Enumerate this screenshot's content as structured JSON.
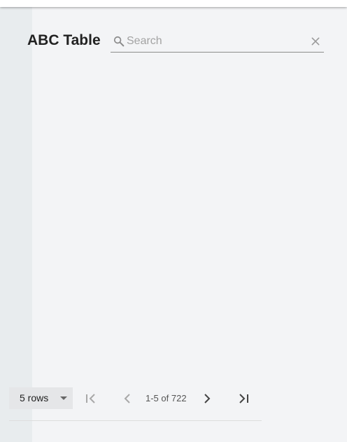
{
  "table": {
    "title": "ABC Table"
  },
  "search": {
    "placeholder": "Search",
    "value": ""
  },
  "pagination": {
    "rows_per_page_label": "5 rows",
    "page_info": "1-5 of 722"
  },
  "icons": {
    "search": "search-icon",
    "clear": "close-icon",
    "dropdown": "caret-down-icon",
    "first_page": "first-page-icon",
    "previous_page": "chevron-left-icon",
    "next_page": "chevron-right-icon",
    "last_page": "last-page-icon"
  },
  "colors": {
    "background": "#f3f4f6",
    "side_strip": "#e8ecee",
    "select_background": "#e5e6e8",
    "enabled_icon": "#444444",
    "disabled_icon": "#a8a8a8"
  }
}
